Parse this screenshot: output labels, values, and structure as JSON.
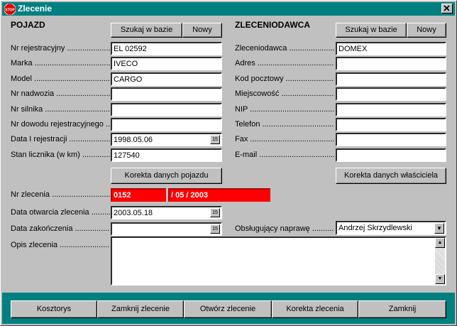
{
  "window": {
    "title": "Zlecenie",
    "titlebar_color": "#008080"
  },
  "vehicle": {
    "section_title": "POJAZD",
    "search_label": "Szukaj w bazie",
    "new_label": "Nowy",
    "fields": [
      {
        "label": "Nr rejestracyjny",
        "value": "EL 02592"
      },
      {
        "label": "Marka",
        "value": "IVECO"
      },
      {
        "label": "Model",
        "value": "CARGO"
      },
      {
        "label": "Nr nadwozia",
        "value": ""
      },
      {
        "label": "Nr silnika",
        "value": ""
      },
      {
        "label": "Nr dowodu rejestracyjnego",
        "value": ""
      },
      {
        "label": "Data I rejestracji",
        "value": "1998.05.06"
      },
      {
        "label": "Stan licznika (w km)",
        "value": "127540"
      }
    ],
    "correct_label": "Korekta danych pojazdu"
  },
  "client": {
    "section_title": "ZLECENIODAWCA",
    "search_label": "Szukaj w bazie",
    "new_label": "Nowy",
    "fields": [
      {
        "label": "Zleceniodawca",
        "value": "DOMEX"
      },
      {
        "label": "Adres",
        "value": ""
      },
      {
        "label": "Kod pocztowy",
        "value": ""
      },
      {
        "label": "Miejscowość",
        "value": ""
      },
      {
        "label": "NIP",
        "value": ""
      },
      {
        "label": "Telefon",
        "value": ""
      },
      {
        "label": "Fax",
        "value": ""
      },
      {
        "label": "E-mail",
        "value": ""
      }
    ],
    "correct_label": "Korekta danych właściciela"
  },
  "order": {
    "number_label": "Nr zlecenia",
    "number_value": "0152",
    "number_suffix": "/ 05 / 2003",
    "open_date_label": "Data otwarcia zlecenia",
    "open_date_value": "2003.05.18",
    "close_date_label": "Data zakończenia",
    "close_date_value": " .  .",
    "handler_label": "Obsługujący naprawę",
    "handler_value": "Andrzej Skrzydlewski",
    "desc_label": "Opis zlecenia",
    "desc_value": "",
    "highlight_color": "#ff0000"
  },
  "calendar_icon_text": "15",
  "bottom_buttons": [
    "Kosztorys",
    "Zamknij zlecenie",
    "Otwórz zlecenie",
    "Korekta zlecenia",
    "Zamknij"
  ]
}
